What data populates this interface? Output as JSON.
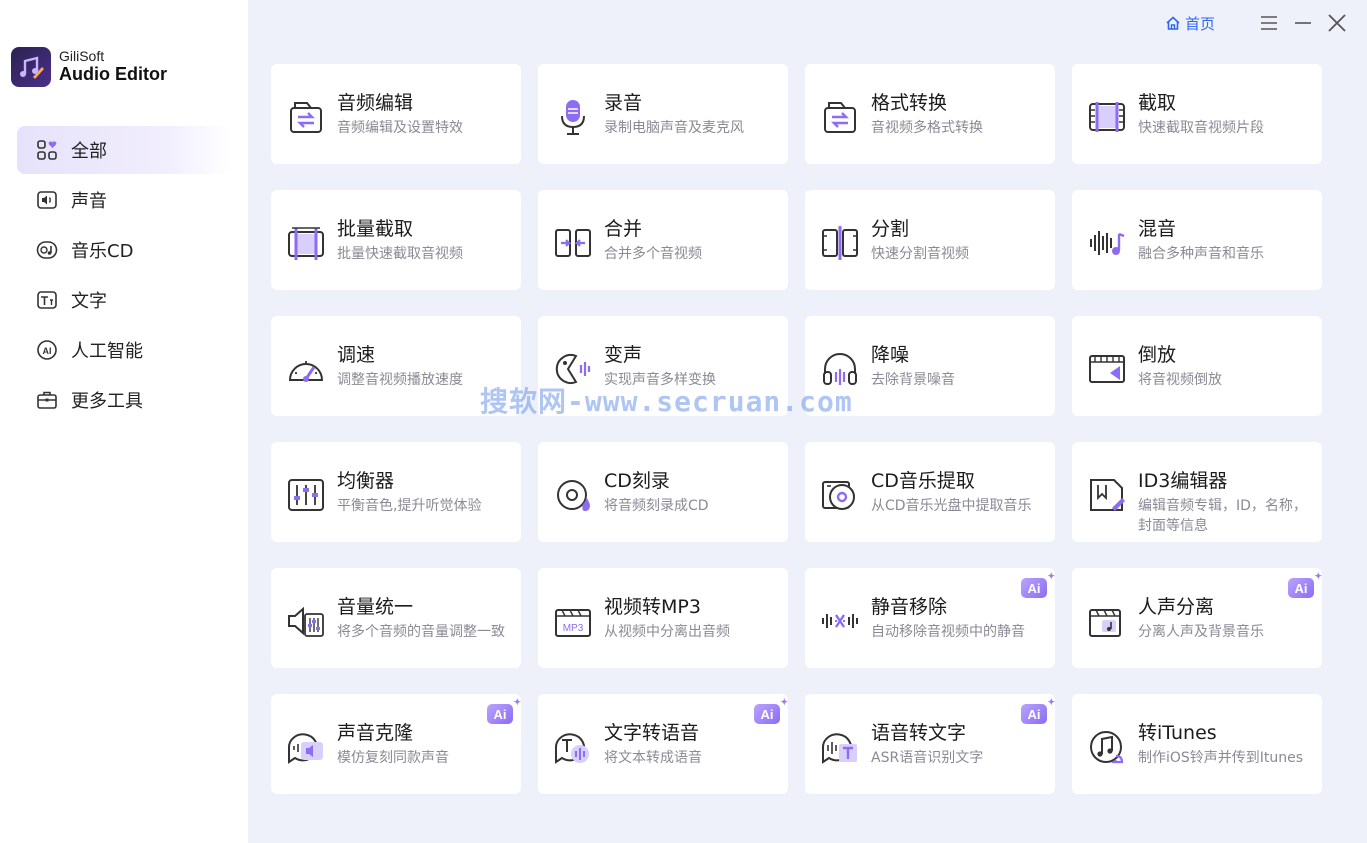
{
  "app": {
    "brand": "GiliSoft",
    "product": "Audio Editor",
    "accent": "#8c6cf2"
  },
  "topbar": {
    "home_label": "首页",
    "home_icon": "home-icon",
    "menu_icon": "menu-icon",
    "minimize_icon": "minimize-icon",
    "close_icon": "close-icon"
  },
  "sidebar": {
    "items": [
      {
        "label": "全部",
        "icon": "grid-heart-icon",
        "active": true
      },
      {
        "label": "声音",
        "icon": "speaker-icon",
        "active": false
      },
      {
        "label": "音乐CD",
        "icon": "music-cd-icon",
        "active": false
      },
      {
        "label": "文字",
        "icon": "text-icon",
        "active": false
      },
      {
        "label": "人工智能",
        "icon": "ai-icon",
        "active": false
      },
      {
        "label": "更多工具",
        "icon": "toolbox-icon",
        "active": false
      }
    ]
  },
  "tools": [
    {
      "title": "音频编辑",
      "desc": "音频编辑及设置特效",
      "icon": "audio-edit-icon",
      "ai": false
    },
    {
      "title": "录音",
      "desc": "录制电脑声音及麦克风",
      "icon": "microphone-icon",
      "ai": false
    },
    {
      "title": "格式转换",
      "desc": "音视频多格式转换",
      "icon": "format-convert-icon",
      "ai": false
    },
    {
      "title": "截取",
      "desc": "快速截取音视频片段",
      "icon": "trim-icon",
      "ai": false
    },
    {
      "title": "批量截取",
      "desc": "批量快速截取音视频",
      "icon": "batch-trim-icon",
      "ai": false
    },
    {
      "title": "合并",
      "desc": "合并多个音视频",
      "icon": "merge-icon",
      "ai": false
    },
    {
      "title": "分割",
      "desc": "快速分割音视频",
      "icon": "split-icon",
      "ai": false
    },
    {
      "title": "混音",
      "desc": "融合多种声音和音乐",
      "icon": "mix-icon",
      "ai": false
    },
    {
      "title": "调速",
      "desc": "调整音视频播放速度",
      "icon": "speed-gauge-icon",
      "ai": false
    },
    {
      "title": "变声",
      "desc": "实现声音多样变换",
      "icon": "voice-change-icon",
      "ai": false
    },
    {
      "title": "降噪",
      "desc": "去除背景噪音",
      "icon": "headphone-denoise-icon",
      "ai": false
    },
    {
      "title": "倒放",
      "desc": "将音视频倒放",
      "icon": "reverse-icon",
      "ai": false
    },
    {
      "title": "均衡器",
      "desc": "平衡音色,提升听觉体验",
      "icon": "equalizer-icon",
      "ai": false
    },
    {
      "title": "CD刻录",
      "desc": "将音频刻录成CD",
      "icon": "cd-burn-icon",
      "ai": false
    },
    {
      "title": "CD音乐提取",
      "desc": "从CD音乐光盘中提取音乐",
      "icon": "cd-rip-icon",
      "ai": false
    },
    {
      "title": "ID3编辑器",
      "desc": "编辑音频专辑，ID，名称，封面等信息",
      "icon": "id3-edit-icon",
      "ai": false
    },
    {
      "title": "音量统一",
      "desc": "将多个音频的音量调整一致",
      "icon": "volume-normalize-icon",
      "ai": false
    },
    {
      "title": "视频转MP3",
      "desc": "从视频中分离出音频",
      "icon": "video-to-mp3-icon",
      "ai": false
    },
    {
      "title": "静音移除",
      "desc": "自动移除音视频中的静音",
      "icon": "silence-remove-icon",
      "ai": true
    },
    {
      "title": "人声分离",
      "desc": "分离人声及背景音乐",
      "icon": "vocal-separate-icon",
      "ai": true
    },
    {
      "title": "声音克隆",
      "desc": "模仿复刻同款声音",
      "icon": "voice-clone-icon",
      "ai": true
    },
    {
      "title": "文字转语音",
      "desc": "将文本转成语音",
      "icon": "text-to-speech-icon",
      "ai": true
    },
    {
      "title": "语音转文字",
      "desc": "ASR语音识别文字",
      "icon": "speech-to-text-icon",
      "ai": true
    },
    {
      "title": "转iTunes",
      "desc": "制作iOS铃声并传到Itunes",
      "icon": "itunes-icon",
      "ai": false
    }
  ],
  "ai_badge_label": "Ai",
  "watermark": "搜软网-www.secruan.com"
}
